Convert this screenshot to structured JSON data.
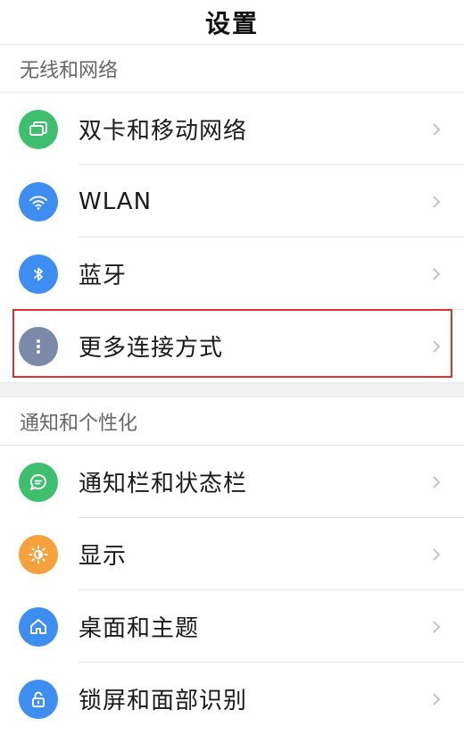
{
  "header": {
    "title": "设置"
  },
  "sections": [
    {
      "title": "无线和网络",
      "items": [
        {
          "label": "双卡和移动网络",
          "icon": "sim-cards-icon",
          "color": "#3dbf6e"
        },
        {
          "label": "WLAN",
          "icon": "wifi-icon",
          "color": "#3d8ef0"
        },
        {
          "label": "蓝牙",
          "icon": "bluetooth-icon",
          "color": "#3d8ef0"
        },
        {
          "label": "更多连接方式",
          "icon": "more-dots-icon",
          "color": "#7a8aa8"
        }
      ]
    },
    {
      "title": "通知和个性化",
      "items": [
        {
          "label": "通知栏和状态栏",
          "icon": "chat-bubble-icon",
          "color": "#3dbf6e"
        },
        {
          "label": "显示",
          "icon": "brightness-icon",
          "color": "#f5a23c"
        },
        {
          "label": "桌面和主题",
          "icon": "home-icon",
          "color": "#3d8ef0"
        },
        {
          "label": "锁屏和面部识别",
          "icon": "lock-icon",
          "color": "#3d8ef0"
        }
      ]
    }
  ],
  "highlight_color": "#e03030"
}
